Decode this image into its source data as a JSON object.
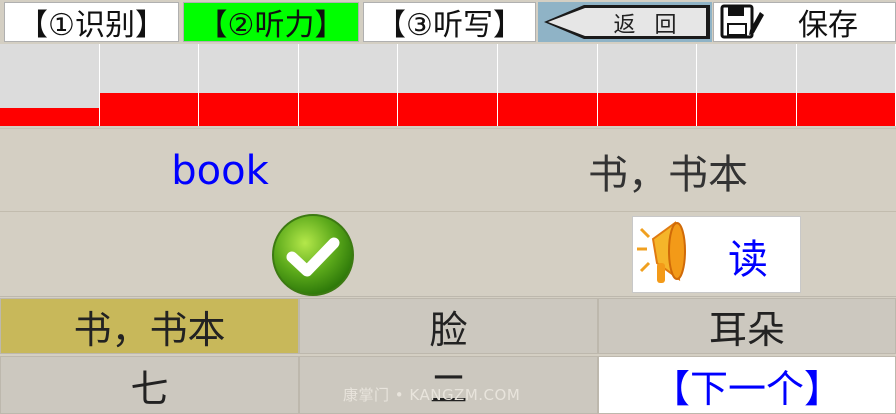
{
  "tabs": [
    {
      "label": "【①识别】",
      "active": false
    },
    {
      "label": "【②听力】",
      "active": true
    },
    {
      "label": "【③听写】",
      "active": false
    }
  ],
  "toolbar": {
    "back_label": "返 回",
    "save_label": "保存"
  },
  "progress": {
    "segments": 9,
    "segment_fill_fractions": [
      0.22,
      0.4,
      0.4,
      0.4,
      0.4,
      0.4,
      0.4,
      0.4,
      0.4
    ]
  },
  "word": {
    "english": "book",
    "chinese": "书，书本"
  },
  "feedback": {
    "state": "correct",
    "icon": "check-icon",
    "read_label": "读"
  },
  "options": [
    {
      "label": "书，书本",
      "selected": true
    },
    {
      "label": "脸",
      "selected": false
    },
    {
      "label": "耳朵",
      "selected": false
    },
    {
      "label": "七",
      "selected": false
    },
    {
      "label": "二",
      "selected": false
    }
  ],
  "next_label": "【下一个】",
  "watermark": "康掌门 • KANGZM.COM",
  "colors": {
    "active_tab": "#00ff00",
    "progress_fill": "#ff0000",
    "english_word": "#0000ff",
    "selected_option": "#c8b85a",
    "next_text": "#0000ff"
  }
}
